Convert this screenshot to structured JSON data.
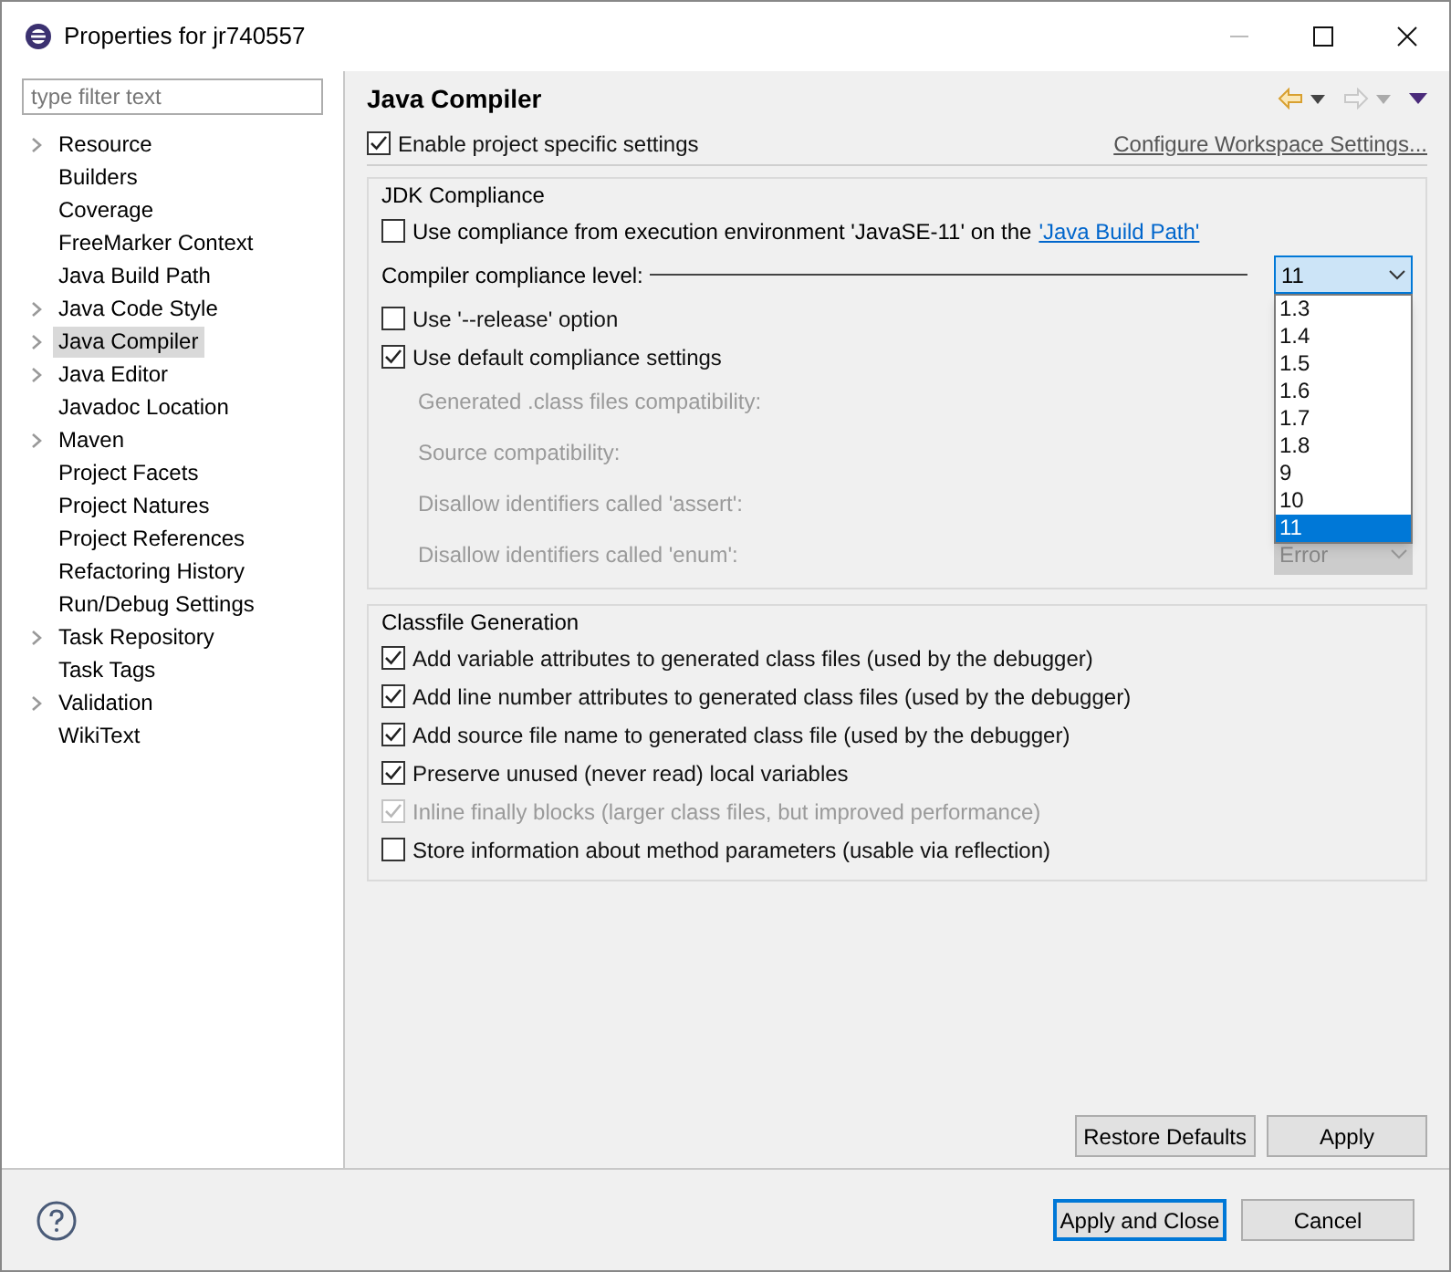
{
  "window": {
    "title": "Properties for jr740557"
  },
  "sidebar": {
    "filter": {
      "placeholder": "type filter text"
    },
    "items": [
      {
        "label": "Resource",
        "expandable": true,
        "selected": false
      },
      {
        "label": "Builders",
        "expandable": false,
        "selected": false
      },
      {
        "label": "Coverage",
        "expandable": false,
        "selected": false
      },
      {
        "label": "FreeMarker Context",
        "expandable": false,
        "selected": false
      },
      {
        "label": "Java Build Path",
        "expandable": false,
        "selected": false
      },
      {
        "label": "Java Code Style",
        "expandable": true,
        "selected": false
      },
      {
        "label": "Java Compiler",
        "expandable": true,
        "selected": true
      },
      {
        "label": "Java Editor",
        "expandable": true,
        "selected": false
      },
      {
        "label": "Javadoc Location",
        "expandable": false,
        "selected": false
      },
      {
        "label": "Maven",
        "expandable": true,
        "selected": false
      },
      {
        "label": "Project Facets",
        "expandable": false,
        "selected": false
      },
      {
        "label": "Project Natures",
        "expandable": false,
        "selected": false
      },
      {
        "label": "Project References",
        "expandable": false,
        "selected": false
      },
      {
        "label": "Refactoring History",
        "expandable": false,
        "selected": false
      },
      {
        "label": "Run/Debug Settings",
        "expandable": false,
        "selected": false
      },
      {
        "label": "Task Repository",
        "expandable": true,
        "selected": false
      },
      {
        "label": "Task Tags",
        "expandable": false,
        "selected": false
      },
      {
        "label": "Validation",
        "expandable": true,
        "selected": false
      },
      {
        "label": "WikiText",
        "expandable": false,
        "selected": false
      }
    ]
  },
  "page": {
    "title": "Java Compiler",
    "enable": {
      "label": "Enable project specific settings",
      "checked": true
    },
    "workspace_link": "Configure Workspace Settings...",
    "jdk": {
      "title": "JDK Compliance",
      "use_env": {
        "label": "Use compliance from execution environment 'JavaSE-11' on the",
        "link": "'Java Build Path'",
        "checked": false
      },
      "level_label": "Compiler compliance level:",
      "level_value": "11",
      "options": [
        {
          "label": "1.3",
          "selected": false
        },
        {
          "label": "1.4",
          "selected": false
        },
        {
          "label": "1.5",
          "selected": false
        },
        {
          "label": "1.6",
          "selected": false
        },
        {
          "label": "1.7",
          "selected": false
        },
        {
          "label": "1.8",
          "selected": false
        },
        {
          "label": "9",
          "selected": false
        },
        {
          "label": "10",
          "selected": false
        },
        {
          "label": "11",
          "selected": true
        }
      ],
      "release": {
        "label": "Use '--release' option",
        "checked": false
      },
      "defaults": {
        "label": "Use default compliance settings",
        "checked": true
      },
      "details": [
        {
          "label": "Generated .class files compatibility:"
        },
        {
          "label": "Source compatibility:"
        },
        {
          "label": "Disallow identifiers called 'assert':"
        },
        {
          "label": "Disallow identifiers called 'enum':",
          "value": "Error"
        }
      ]
    },
    "classfile": {
      "title": "Classfile Generation",
      "options": [
        {
          "label": "Add variable attributes to generated class files (used by the debugger)",
          "checked": true,
          "disabled": false
        },
        {
          "label": "Add line number attributes to generated class files (used by the debugger)",
          "checked": true,
          "disabled": false
        },
        {
          "label": "Add source file name to generated class file (used by the debugger)",
          "checked": true,
          "disabled": false
        },
        {
          "label": "Preserve unused (never read) local variables",
          "checked": true,
          "disabled": false
        },
        {
          "label": "Inline finally blocks (larger class files, but improved performance)",
          "checked": true,
          "disabled": true
        },
        {
          "label": "Store information about method parameters (usable via reflection)",
          "checked": false,
          "disabled": false
        }
      ]
    }
  },
  "buttons": {
    "restore": "Restore Defaults",
    "apply": "Apply",
    "apply_close": "Apply and Close",
    "cancel": "Cancel"
  }
}
